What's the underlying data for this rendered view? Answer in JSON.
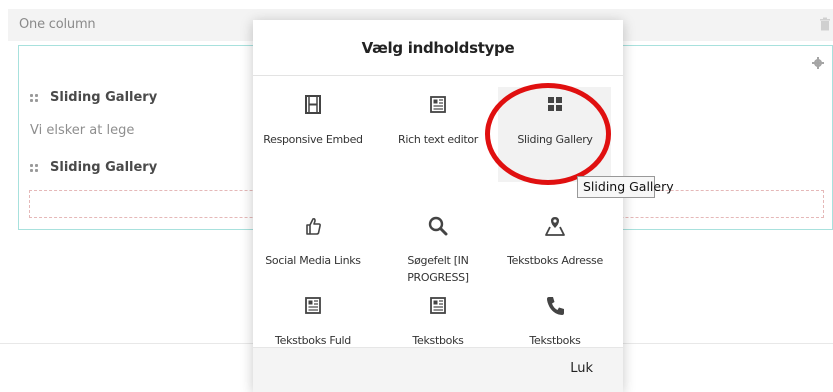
{
  "section": {
    "title": "One column",
    "items": [
      {
        "label": "Sliding Gallery"
      },
      {
        "label": "Sliding Gallery"
      }
    ],
    "text_block": "Vi elsker at lege"
  },
  "dialog": {
    "title": "Vælg indholdstype",
    "close_label": "Luk",
    "types": [
      {
        "label": "Responsive Embed",
        "icon": "film-icon"
      },
      {
        "label": "Rich text editor",
        "icon": "document-icon"
      },
      {
        "label": "Sliding Gallery",
        "icon": "grid-icon",
        "highlighted": true
      },
      {
        "label": "Social Media Links",
        "icon": "thumbs-up-icon"
      },
      {
        "label": "Søgefelt [IN PROGRESS]",
        "icon": "search-icon"
      },
      {
        "label": "Tekstboks Adresse",
        "icon": "map-pin-icon"
      },
      {
        "label": "Tekstboks Fuld",
        "icon": "document-icon"
      },
      {
        "label": "Tekstboks",
        "icon": "document-icon"
      },
      {
        "label": "Tekstboks",
        "icon": "phone-icon"
      }
    ]
  },
  "tooltip": "Sliding Gallery",
  "colors": {
    "accent_border": "#a8e1dd",
    "annotation_circle": "#e01010",
    "dashed_border": "#e5b8b8"
  }
}
